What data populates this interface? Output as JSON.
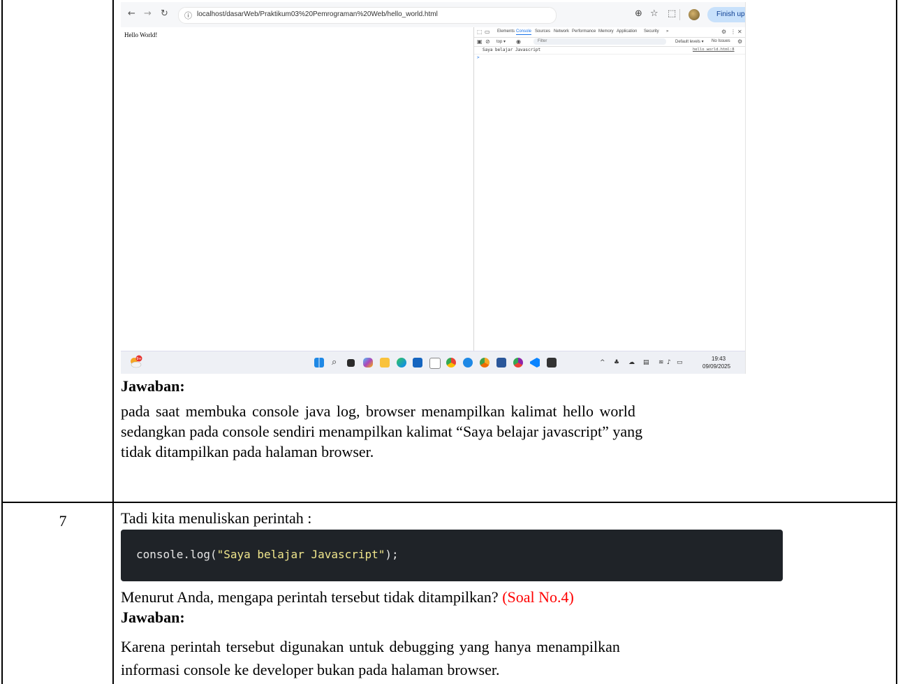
{
  "row7_number": "7",
  "screenshot": {
    "browser": {
      "url": "localhost/dasarWeb/Praktikum03%20Pemrograman%20Web/hello_world.html",
      "finish_update_label": "Finish update",
      "page_text": "Hello World!"
    },
    "devtools": {
      "tabs": [
        "Elements",
        "Console",
        "Sources",
        "Network",
        "Performance",
        "Memory",
        "Application",
        "Security"
      ],
      "more_tabs": "»",
      "context": "top ▾",
      "filter_placeholder": "Filter",
      "levels": "Default levels ▾",
      "issues": "No Issues",
      "log_message": "Saya belajar Javascript",
      "log_source": "hello_world.html:8",
      "prompt": ">"
    },
    "taskbar": {
      "weather_badge": "9+",
      "clock_time": "19:43",
      "clock_date": "09/09/2025",
      "icons": [
        "windows-start-icon",
        "search-icon",
        "task-view-icon",
        "copilot-icon",
        "file-explorer-icon",
        "edge-icon",
        "store-icon",
        "amazon-icon",
        "chrome-icon",
        "app-icon",
        "chrome-canary-icon",
        "word-icon",
        "chrome-dev-icon",
        "vscode-icon",
        "terminal-icon"
      ]
    }
  },
  "answer1": {
    "heading": "Jawaban:",
    "line1": "pada saat membuka console java log, browser menampilkan kalimat hello world",
    "line2": "sedangkan pada console sendiri menampilkan kalimat “Saya belajar javascript” yang",
    "line3": "tidak ditampilkan pada halaman browser."
  },
  "question7": {
    "intro": "Tadi kita menuliskan perintah :",
    "code_prefix": "console.log(",
    "code_string": "\"Saya belajar Javascript\"",
    "code_suffix": ");",
    "question": "Menurut Anda, mengapa perintah tersebut tidak ditampilkan?",
    "question_ref": "(Soal No.4)",
    "answer_heading": "Jawaban:",
    "answer_line1": "Karena perintah tersebut digunakan untuk debugging yang hanya menampilkan",
    "answer_line2": "informasi console ke developer bukan pada halaman browser."
  }
}
